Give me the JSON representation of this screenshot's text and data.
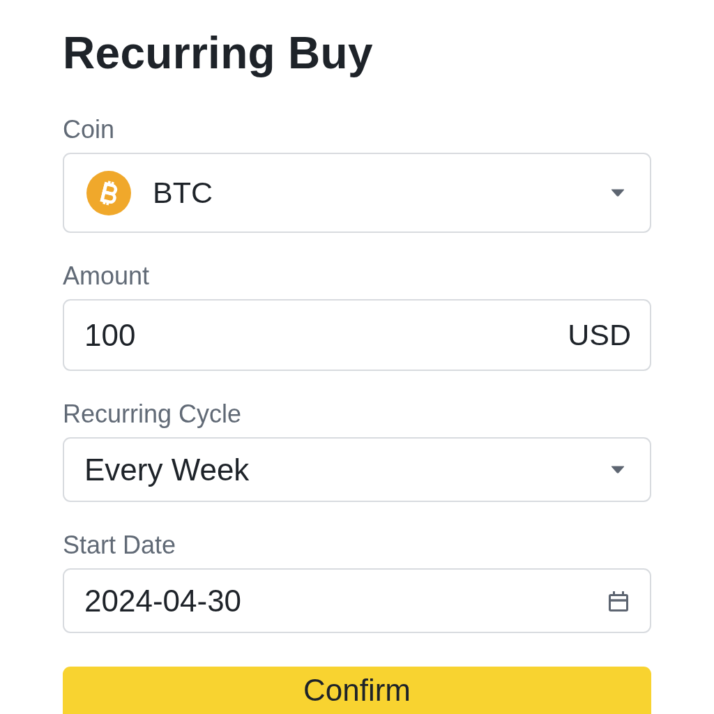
{
  "title": "Recurring Buy",
  "fields": [
    {
      "kind": "coin",
      "label": "Coin",
      "value": "BTC"
    },
    {
      "kind": "amount",
      "label": "Amount",
      "value": "100",
      "unit": "USD"
    },
    {
      "kind": "select",
      "label": "Recurring Cycle",
      "value": "Every Week"
    },
    {
      "kind": "date",
      "label": "Start Date",
      "value": "2024-04-30"
    }
  ],
  "confirm_button": {
    "label": "Confirm"
  }
}
